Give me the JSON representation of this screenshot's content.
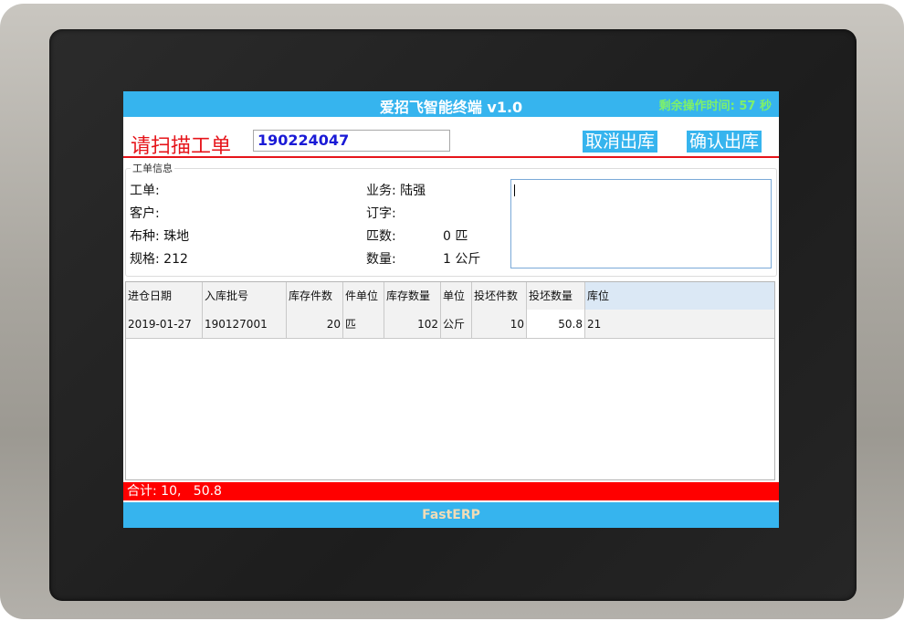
{
  "app": {
    "title": "爱招飞智能终端 v1.0",
    "timer": "剩余操作时间: 57 秒"
  },
  "scan": {
    "label": "请扫描工单",
    "value": "190224047"
  },
  "actions": {
    "cancel_label": "取消出库",
    "confirm_label": "确认出库"
  },
  "info": {
    "group_title": "工单信息",
    "work_order": "工单:",
    "business": "业务: 陆强",
    "customer": "客户:",
    "order_word": "订字:",
    "fabric": "布种: 珠地",
    "pieces_label": "匹数:",
    "pieces_value": "0 匹",
    "spec": "规格: 212",
    "qty_label": "数量:",
    "qty_value": "1 公斤"
  },
  "table": {
    "headers": [
      "进仓日期",
      "入库批号",
      "库存件数",
      "件单位",
      "库存数量",
      "单位",
      "投坯件数",
      "投坯数量",
      "库位"
    ],
    "rows": [
      [
        "2019-01-27",
        "190127001",
        "20",
        "匹",
        "102",
        "公斤",
        "10",
        "50.8",
        "21"
      ]
    ]
  },
  "total": {
    "text": "合计: 10,   50.8"
  },
  "footer": {
    "brand": "FastERP"
  }
}
